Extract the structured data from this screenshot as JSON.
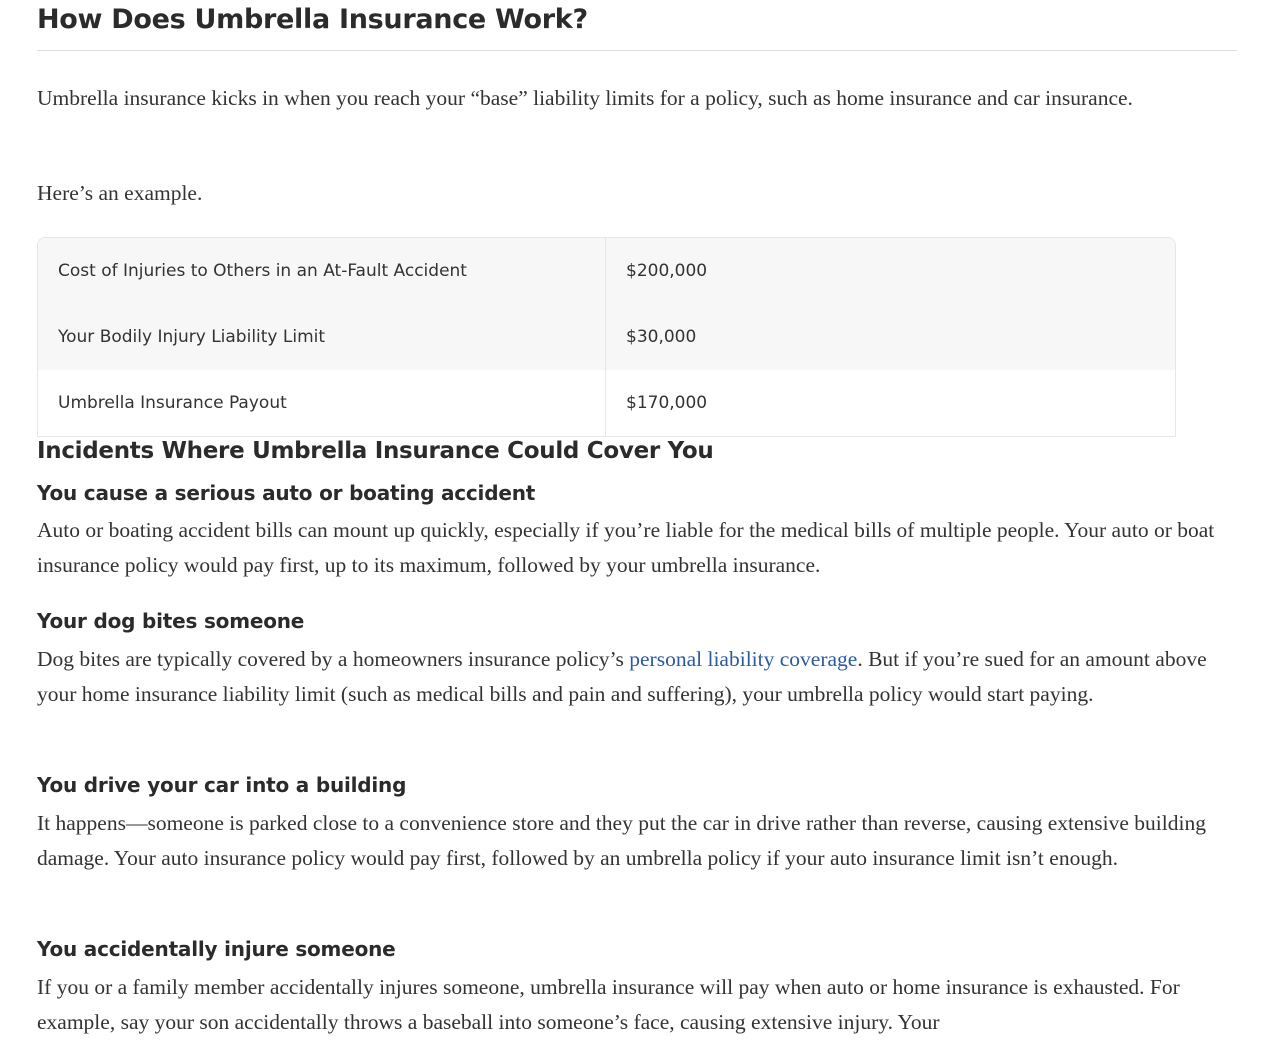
{
  "article": {
    "title": "How Does Umbrella Insurance Work?",
    "intro": "Umbrella insurance kicks in when you reach your “base” liability limits for a policy, such as home insurance and car insurance.",
    "example_lead": "Here’s an example.",
    "table": {
      "rows": [
        {
          "label": "Cost of Injuries to Others in an At-Fault Accident",
          "value": "$200,000"
        },
        {
          "label": "Your Bodily Injury Liability Limit",
          "value": "$30,000"
        },
        {
          "label": "Umbrella Insurance Payout",
          "value": "$170,000"
        }
      ]
    },
    "incidents_heading": "Incidents Where Umbrella Insurance Could Cover You",
    "incidents": [
      {
        "heading": "You cause a serious auto or boating accident",
        "text": "Auto or boating accident bills can mount up quickly, especially if you’re liable for the medical bills of multiple people. Your auto or boat insurance policy would pay first, up to its maximum, followed by your umbrella insurance."
      },
      {
        "heading": "Your dog bites someone",
        "text_before": "Dog bites are typically covered by a homeowners insurance policy’s ",
        "link": "personal liability coverage",
        "text_after": ". But if you’re sued for an amount above your home insurance liability limit (such as medical bills and pain and suffering), your umbrella policy would start paying."
      },
      {
        "heading": "You drive your car into a building",
        "text": "It happens—someone is parked close to a convenience store and they put the car in drive rather than reverse, causing extensive building damage. Your auto insurance policy would pay first, followed by an umbrella policy if your auto insurance limit isn’t enough."
      },
      {
        "heading": "You accidentally injure someone",
        "text": "If you or a family member accidentally injures someone, umbrella insurance will pay when auto or home insurance is exhausted. For example, say your son accidentally throws a baseball into someone’s face, causing extensive injury. Your"
      }
    ],
    "colors": {
      "text": "#333333",
      "heading": "#2b2b2b",
      "link": "#2c5aa0",
      "table_shade": "#f7f7f7",
      "border": "#e6e6e6"
    }
  }
}
